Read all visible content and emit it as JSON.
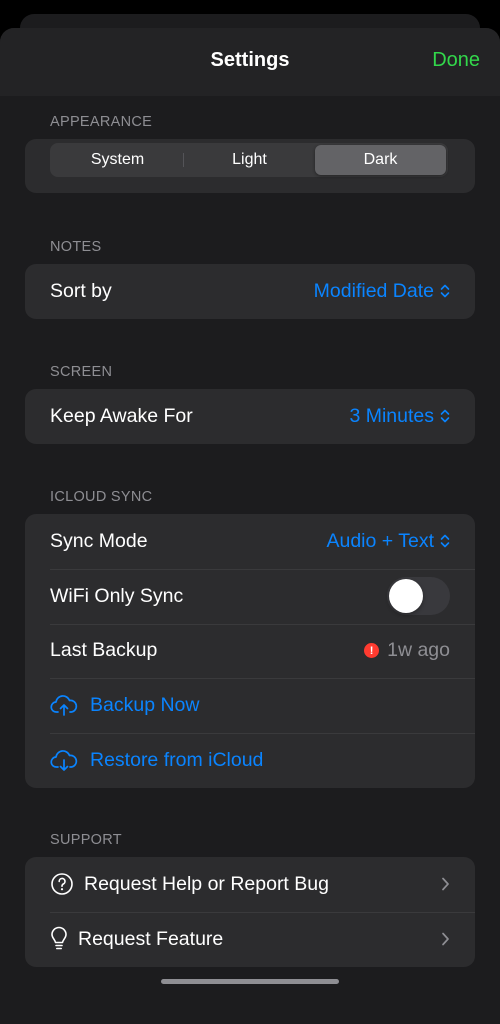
{
  "nav": {
    "title": "Settings",
    "done_label": "Done"
  },
  "appearance": {
    "header": "APPEARANCE",
    "options": [
      "System",
      "Light",
      "Dark"
    ],
    "selected": "Dark"
  },
  "notes": {
    "header": "NOTES",
    "sort_label": "Sort by",
    "sort_value": "Modified Date"
  },
  "screen": {
    "header": "SCREEN",
    "awake_label": "Keep Awake For",
    "awake_value": "3 Minutes"
  },
  "icloud": {
    "header": "ICLOUD SYNC",
    "sync_mode_label": "Sync Mode",
    "sync_mode_value": "Audio + Text",
    "wifi_label": "WiFi Only Sync",
    "wifi_on": false,
    "last_backup_label": "Last Backup",
    "last_backup_value": "1w ago",
    "alert_glyph": "!",
    "backup_now_label": "Backup Now",
    "backup_now_icon": "cloud-upload-icon",
    "restore_label": "Restore from iCloud",
    "restore_icon": "cloud-download-icon"
  },
  "support": {
    "header": "SUPPORT",
    "help_label": "Request Help or Report Bug",
    "help_icon": "question-circle-icon",
    "feature_label": "Request Feature",
    "feature_icon": "lightbulb-icon"
  },
  "colors": {
    "background": "#000000",
    "sheet": "#1c1c1e",
    "cell": "#2c2c2e",
    "accent_blue": "#0a84ff",
    "done_green": "#32d74b",
    "alert_red": "#ff3b30",
    "secondary_text": "#8e8e93"
  }
}
